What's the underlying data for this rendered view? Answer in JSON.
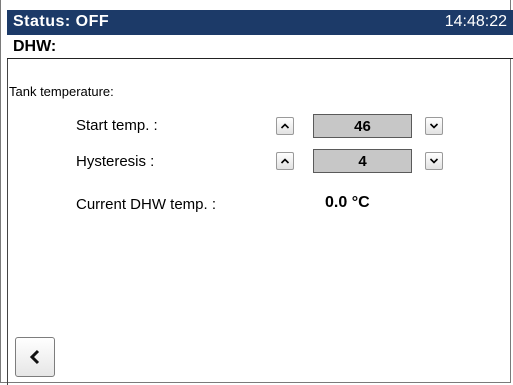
{
  "header": {
    "status": "Status: OFF",
    "time": "14:48:22"
  },
  "section": {
    "title": "DHW:"
  },
  "tank": {
    "group_label": "Tank temperature:",
    "start_temp": {
      "label": "Start temp. :",
      "value": "46",
      "up_icon": "chevron-up-icon",
      "down_icon": "chevron-down-icon"
    },
    "hysteresis": {
      "label": "Hysteresis :",
      "value": "4",
      "up_icon": "chevron-up-icon",
      "down_icon": "chevron-down-icon"
    },
    "current_dhw": {
      "label": "Current DHW temp. :",
      "value": "0.0 °C"
    }
  },
  "navigation": {
    "back_icon": "chevron-left-icon"
  },
  "colors": {
    "titlebar": "#1c3a68",
    "value_box": "#c7c7c7"
  }
}
